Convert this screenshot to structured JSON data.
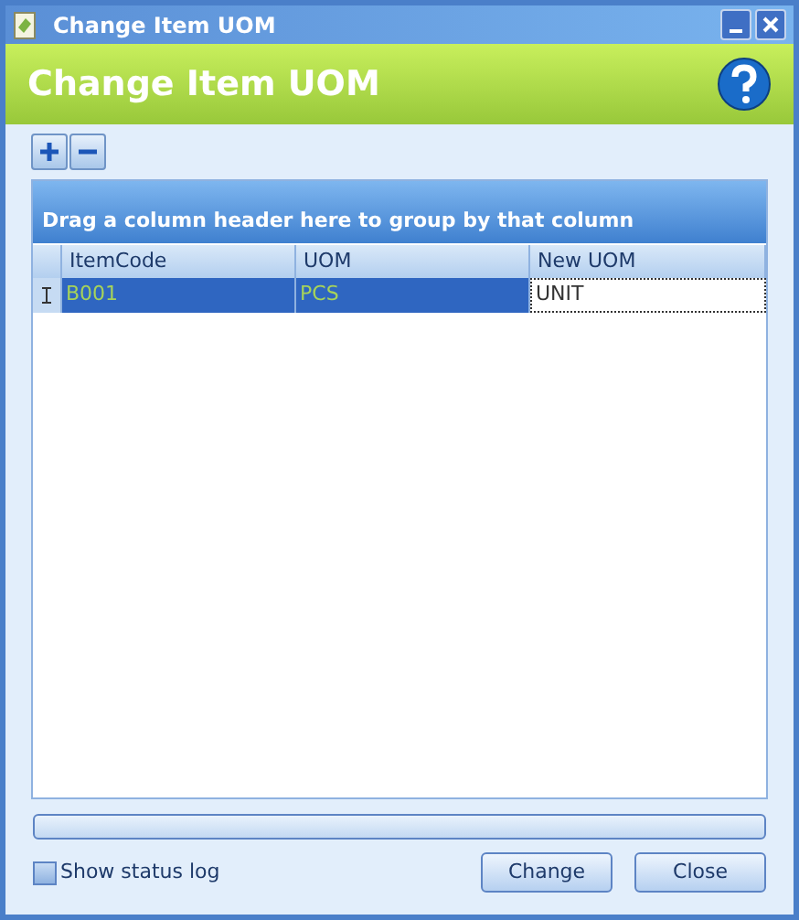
{
  "window": {
    "title": "Change Item UOM"
  },
  "header": {
    "title": "Change Item UOM"
  },
  "grid": {
    "group_panel": "Drag a column header here to group by that column",
    "columns": [
      "ItemCode",
      "UOM",
      "New UOM"
    ],
    "rows": [
      {
        "selected": true,
        "editing": true,
        "cells": [
          "B001",
          "PCS",
          "UNIT"
        ]
      }
    ]
  },
  "progress": {
    "level": 0
  },
  "show_status_log": {
    "label": "Show status log",
    "checked": false
  },
  "buttons": [
    "Change",
    "Close"
  ]
}
